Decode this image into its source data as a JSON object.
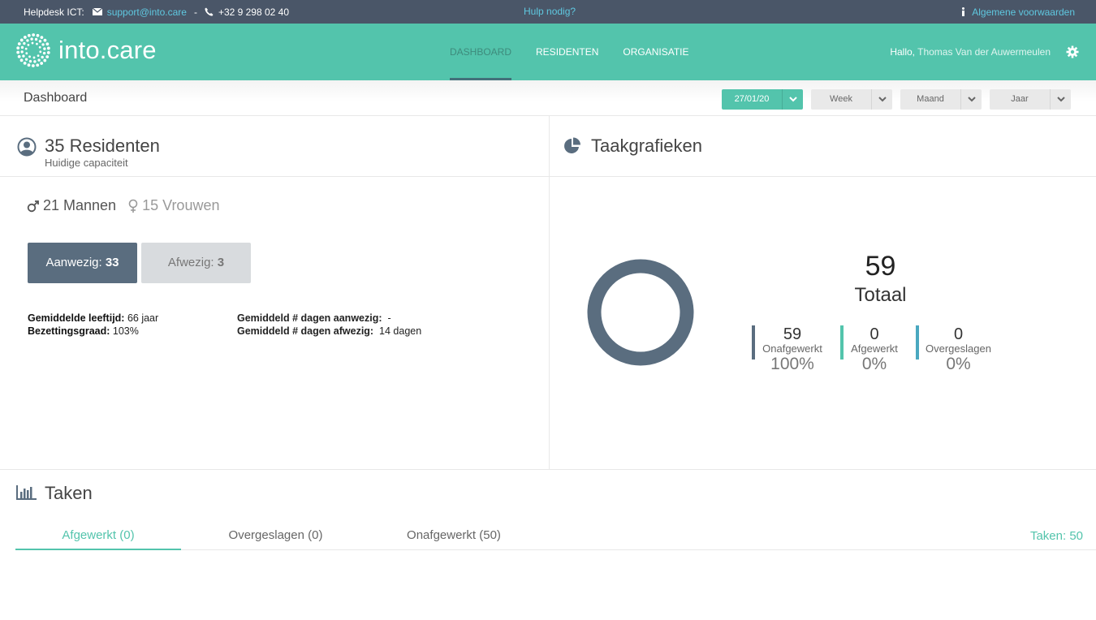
{
  "topbar": {
    "helpdesk_label": "Helpdesk ICT:",
    "email": "support@into.care",
    "separator": "-",
    "phone": "+32 9 298 02 40",
    "help_link": "Hulp nodig?",
    "terms_link": "Algemene voorwaarden"
  },
  "header": {
    "logo_text": "into.care",
    "nav": [
      {
        "label": "DASHBOARD",
        "active": true
      },
      {
        "label": "RESIDENTEN",
        "active": false
      },
      {
        "label": "ORGANISATIE",
        "active": false
      }
    ],
    "greeting": "Hallo,",
    "user_name": "Thomas Van der Auwermeulen"
  },
  "subheader": {
    "title": "Dashboard",
    "filters": {
      "date": "27/01/20",
      "week": "Week",
      "month": "Maand",
      "year": "Jaar"
    }
  },
  "residents": {
    "title": "35 Residenten",
    "subtitle": "Huidige capaciteit",
    "men": "21 Mannen",
    "women": "15 Vrouwen",
    "present_label": "Aanwezig:",
    "present_value": "33",
    "absent_label": "Afwezig:",
    "absent_value": "3",
    "avg_age_label": "Gemiddelde leeftijd:",
    "avg_age_value": "66 jaar",
    "occupancy_label": "Bezettingsgraad:",
    "occupancy_value": "103%",
    "avg_days_present_label": "Gemiddeld # dagen aanwezig:",
    "avg_days_present_value": "-",
    "avg_days_absent_label": "Gemiddeld # dagen afwezig:",
    "avg_days_absent_value": "14 dagen"
  },
  "task_charts": {
    "title": "Taakgrafieken",
    "total_value": "59",
    "total_label": "Totaal",
    "donut_color": "#5a6d7f",
    "metrics": [
      {
        "value": "59",
        "label": "Onafgewerkt",
        "percent": "100%",
        "color": "#5a6d7f"
      },
      {
        "value": "0",
        "label": "Afgewerkt",
        "percent": "0%",
        "color": "#53c4ac"
      },
      {
        "value": "0",
        "label": "Overgeslagen",
        "percent": "0%",
        "color": "#4aa8c0"
      }
    ]
  },
  "tasks": {
    "title": "Taken",
    "tabs": [
      {
        "label": "Afgewerkt (0)",
        "active": true
      },
      {
        "label": "Overgeslagen (0)",
        "active": false
      },
      {
        "label": "Onafgewerkt (50)",
        "active": false
      }
    ],
    "count": "Taken: 50"
  },
  "colors": {
    "brand": "#53c4ac",
    "topbar": "#4a5668",
    "link": "#5fc8e0",
    "slate": "#5a6d7f"
  }
}
